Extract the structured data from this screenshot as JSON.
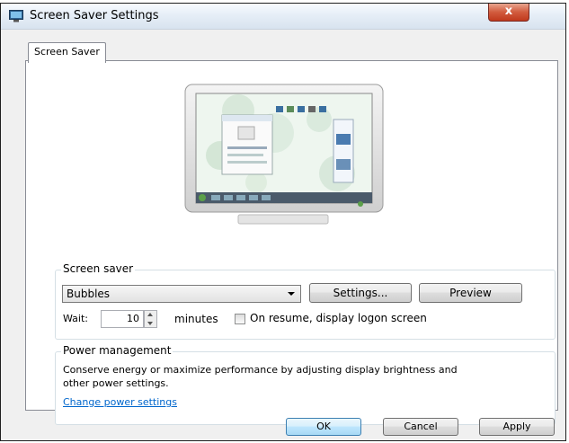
{
  "window": {
    "title": "Screen Saver Settings",
    "close_glyph": "x"
  },
  "tabs": [
    {
      "label": "Screen Saver",
      "selected": true
    }
  ],
  "screensaver": {
    "group_label": "Screen saver",
    "selected": "Bubbles",
    "settings_label": "Settings...",
    "preview_label": "Preview",
    "wait_label": "Wait:",
    "wait_value": "10",
    "minutes_label": "minutes",
    "resume_label": "On resume, display logon screen",
    "resume_checked": false
  },
  "power": {
    "group_label": "Power management",
    "description": "Conserve energy or maximize performance by adjusting display brightness and other power settings.",
    "link": "Change power settings"
  },
  "buttons": {
    "ok": "OK",
    "cancel": "Cancel",
    "apply": "Apply"
  },
  "colors": {
    "link": "#0066cc",
    "close": "#c0391c",
    "ok_highlight": "#3c7fb1"
  }
}
